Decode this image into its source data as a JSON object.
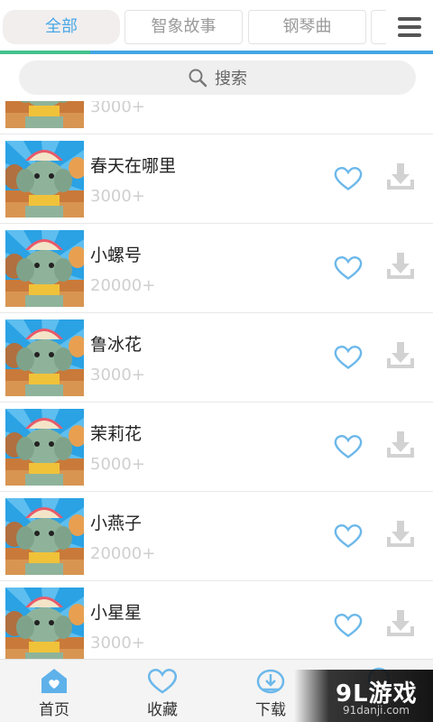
{
  "tabs": [
    {
      "label": "全部",
      "active": true
    },
    {
      "label": "智象故事",
      "active": false
    },
    {
      "label": "钢琴曲",
      "active": false
    },
    {
      "label": "",
      "active": false
    }
  ],
  "menu_icon": "hamburger-menu-icon",
  "search": {
    "placeholder": "搜索",
    "icon": "search-icon"
  },
  "songs": [
    {
      "title": "",
      "count": "3000+"
    },
    {
      "title": "春天在哪里",
      "count": "3000+"
    },
    {
      "title": "小螺号",
      "count": "20000+"
    },
    {
      "title": "鲁冰花",
      "count": "3000+"
    },
    {
      "title": "茉莉花",
      "count": "5000+"
    },
    {
      "title": "小燕子",
      "count": "20000+"
    },
    {
      "title": "小星星",
      "count": "3000+"
    }
  ],
  "bottom_nav": [
    {
      "label": "首页",
      "icon": "home-icon",
      "active": true
    },
    {
      "label": "收藏",
      "icon": "heart-icon",
      "active": false
    },
    {
      "label": "下载",
      "icon": "download-icon",
      "active": false
    },
    {
      "label": "",
      "icon": "more-icon",
      "active": false
    }
  ],
  "watermark": {
    "main": "9L游戏",
    "sub": "91danji.com"
  },
  "colors": {
    "accent": "#4aa8e6",
    "icon_blue": "#6cb8ea",
    "download_gray": "#d0d0d0"
  }
}
